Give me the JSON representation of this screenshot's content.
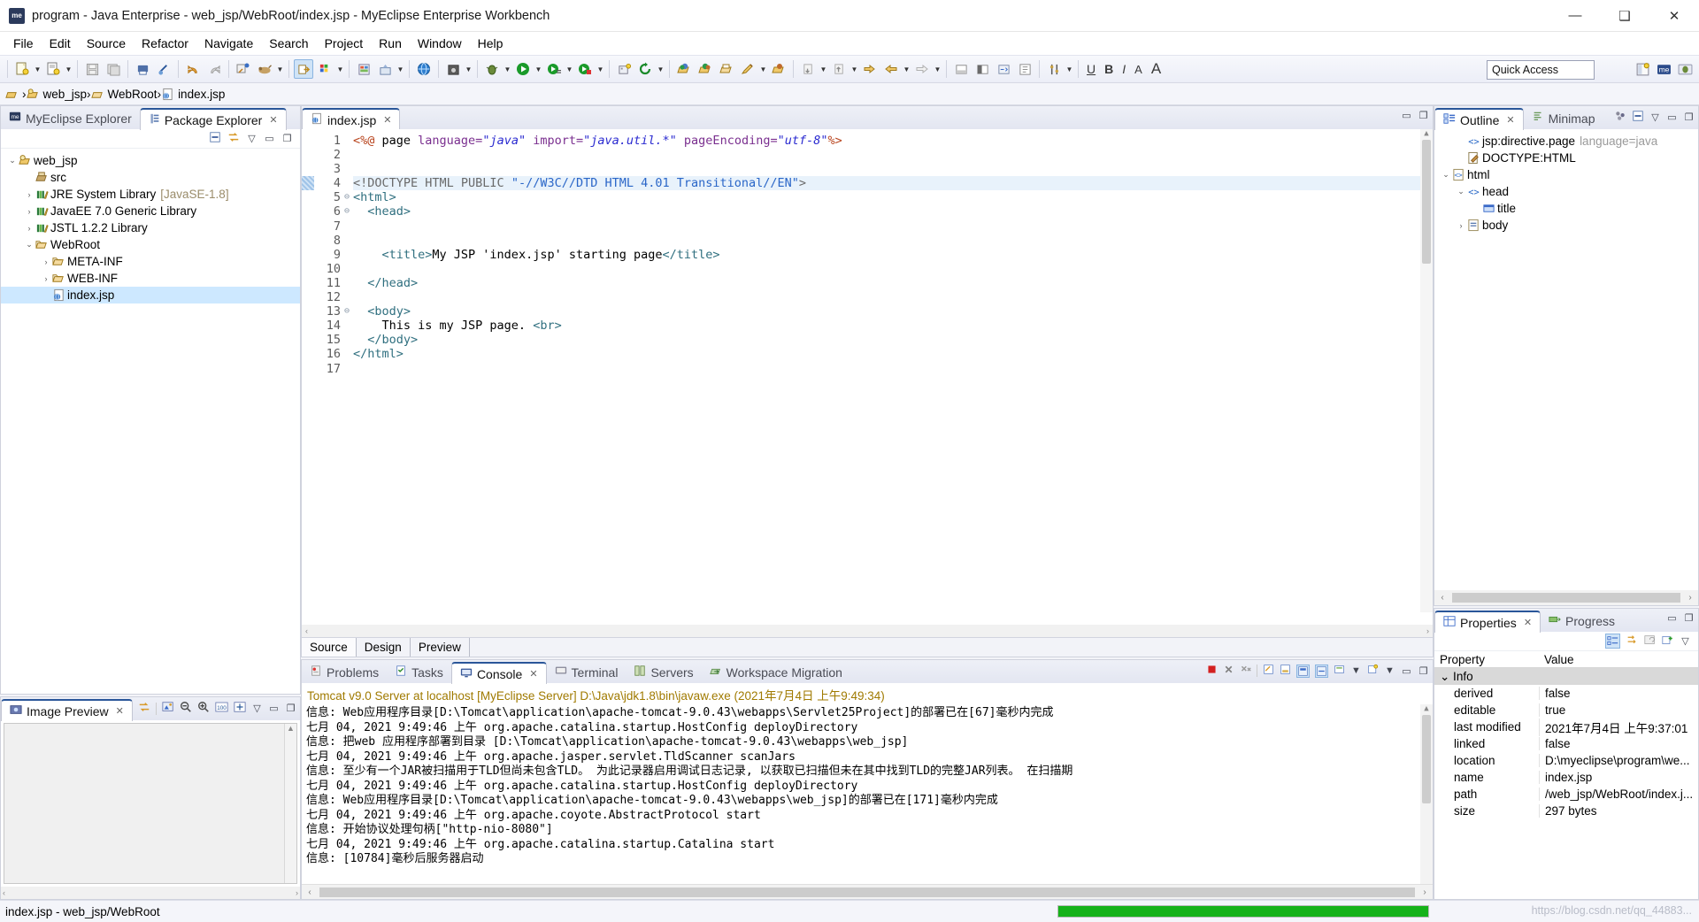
{
  "window": {
    "title": "program - Java Enterprise - web_jsp/WebRoot/index.jsp - MyEclipse Enterprise Workbench",
    "app_badge": "me",
    "minimize": "—",
    "maximize": "❑",
    "close": "✕"
  },
  "menu": [
    {
      "label": "File"
    },
    {
      "label": "Edit"
    },
    {
      "label": "Source"
    },
    {
      "label": "Refactor"
    },
    {
      "label": "Navigate"
    },
    {
      "label": "Search"
    },
    {
      "label": "Project"
    },
    {
      "label": "Run"
    },
    {
      "label": "Window"
    },
    {
      "label": "Help"
    }
  ],
  "toolbar": {
    "quick_access_value": "Quick Access",
    "text_buttons": [
      "U",
      "B",
      "I",
      "A",
      "A"
    ]
  },
  "breadcrumb": {
    "items": [
      "web_jsp",
      "WebRoot",
      "index.jsp"
    ],
    "separator": "›"
  },
  "explorer": {
    "tabs": [
      {
        "label": "MyEclipse Explorer",
        "active": false,
        "icon": "myeclipse-icon"
      },
      {
        "label": "Package Explorer",
        "active": true,
        "icon": "package-icon"
      }
    ],
    "tree": [
      {
        "label": "web_jsp",
        "indent": 0,
        "twist": "⌄",
        "icon": "project-icon",
        "dim": "",
        "selected": false
      },
      {
        "label": "src",
        "indent": 1,
        "twist": "",
        "icon": "source-folder-icon",
        "dim": "",
        "selected": false
      },
      {
        "label": "JRE System Library",
        "indent": 1,
        "twist": "›",
        "icon": "library-icon",
        "dim": "[JavaSE-1.8]",
        "selected": false
      },
      {
        "label": "JavaEE 7.0 Generic Library",
        "indent": 1,
        "twist": "›",
        "icon": "library-icon",
        "dim": "",
        "selected": false
      },
      {
        "label": "JSTL 1.2.2 Library",
        "indent": 1,
        "twist": "›",
        "icon": "library-icon",
        "dim": "",
        "selected": false
      },
      {
        "label": "WebRoot",
        "indent": 1,
        "twist": "⌄",
        "icon": "folder-icon",
        "dim": "",
        "selected": false
      },
      {
        "label": "META-INF",
        "indent": 2,
        "twist": "›",
        "icon": "folder-icon",
        "dim": "",
        "selected": false
      },
      {
        "label": "WEB-INF",
        "indent": 2,
        "twist": "›",
        "icon": "folder-icon",
        "dim": "",
        "selected": false
      },
      {
        "label": "index.jsp",
        "indent": 2,
        "twist": "",
        "icon": "jsp-file-icon",
        "dim": "",
        "selected": true
      }
    ]
  },
  "image_preview": {
    "tab_label": "Image Preview"
  },
  "editor": {
    "tab_label": "index.jsp",
    "source_tabs": [
      {
        "label": "Source",
        "active": true
      },
      {
        "label": "Design",
        "active": false
      },
      {
        "label": "Preview",
        "active": false
      }
    ],
    "total_lines": 17,
    "highlight_line": 4,
    "fold_lines": [
      5,
      6,
      13
    ],
    "lines": [
      {
        "n": 1,
        "segments": [
          {
            "t": "<%@ ",
            "c": "k-dir"
          },
          {
            "t": "page ",
            "c": "k-txt"
          },
          {
            "t": "language=",
            "c": "k-attr"
          },
          {
            "t": "\"java\"",
            "c": "k-str"
          },
          {
            "t": " import=",
            "c": "k-attr"
          },
          {
            "t": "\"java.util.*\"",
            "c": "k-str"
          },
          {
            "t": " pageEncoding=",
            "c": "k-attr"
          },
          {
            "t": "\"utf-8\"",
            "c": "k-str"
          },
          {
            "t": "%>",
            "c": "k-dir"
          }
        ]
      },
      {
        "n": 2,
        "segments": []
      },
      {
        "n": 3,
        "segments": []
      },
      {
        "n": 4,
        "segments": [
          {
            "t": "<!DOCTYPE HTML PUBLIC ",
            "c": "k-doc"
          },
          {
            "t": "\"-//W3C//DTD HTML 4.01 Transitional//EN\"",
            "c": "k-docs"
          },
          {
            "t": ">",
            "c": "k-doc"
          }
        ]
      },
      {
        "n": 5,
        "segments": [
          {
            "t": "<html>",
            "c": "k-tag"
          }
        ]
      },
      {
        "n": 6,
        "segments": [
          {
            "t": "  <head>",
            "c": "k-tag"
          }
        ]
      },
      {
        "n": 7,
        "segments": []
      },
      {
        "n": 8,
        "segments": []
      },
      {
        "n": 9,
        "segments": [
          {
            "t": "    <title>",
            "c": "k-tag"
          },
          {
            "t": "My JSP 'index.jsp' starting page",
            "c": "k-txt"
          },
          {
            "t": "</title>",
            "c": "k-tag"
          }
        ]
      },
      {
        "n": 10,
        "segments": []
      },
      {
        "n": 11,
        "segments": [
          {
            "t": "  </head>",
            "c": "k-tag"
          }
        ]
      },
      {
        "n": 12,
        "segments": []
      },
      {
        "n": 13,
        "segments": [
          {
            "t": "  <body>",
            "c": "k-tag"
          }
        ]
      },
      {
        "n": 14,
        "segments": [
          {
            "t": "    This is my JSP page. ",
            "c": "k-txt"
          },
          {
            "t": "<br>",
            "c": "k-tag"
          }
        ]
      },
      {
        "n": 15,
        "segments": [
          {
            "t": "  </body>",
            "c": "k-tag"
          }
        ]
      },
      {
        "n": 16,
        "segments": [
          {
            "t": "</html>",
            "c": "k-tag"
          }
        ]
      },
      {
        "n": 17,
        "segments": []
      }
    ]
  },
  "console": {
    "tabs": [
      {
        "label": "Problems",
        "active": false,
        "icon": "problems-icon"
      },
      {
        "label": "Tasks",
        "active": false,
        "icon": "tasks-icon"
      },
      {
        "label": "Console",
        "active": true,
        "icon": "console-icon"
      },
      {
        "label": "Terminal",
        "active": false,
        "icon": "terminal-icon"
      },
      {
        "label": "Servers",
        "active": false,
        "icon": "servers-icon"
      },
      {
        "label": "Workspace Migration",
        "active": false,
        "icon": "migration-icon"
      }
    ],
    "header": "Tomcat v9.0 Server at localhost [MyEclipse Server] D:\\Java\\jdk1.8\\bin\\javaw.exe (2021年7月4日 上午9:49:34)",
    "lines": [
      "信息: Web应用程序目录[D:\\Tomcat\\application\\apache-tomcat-9.0.43\\webapps\\Servlet25Project]的部署已在[67]毫秒内完成",
      "七月 04, 2021 9:49:46 上午 org.apache.catalina.startup.HostConfig deployDirectory",
      "信息: 把web 应用程序部署到目录 [D:\\Tomcat\\application\\apache-tomcat-9.0.43\\webapps\\web_jsp]",
      "七月 04, 2021 9:49:46 上午 org.apache.jasper.servlet.TldScanner scanJars",
      "信息: 至少有一个JAR被扫描用于TLD但尚未包含TLD。 为此记录器启用调试日志记录, 以获取已扫描但未在其中找到TLD的完整JAR列表。 在扫描期",
      "七月 04, 2021 9:49:46 上午 org.apache.catalina.startup.HostConfig deployDirectory",
      "信息: Web应用程序目录[D:\\Tomcat\\application\\apache-tomcat-9.0.43\\webapps\\web_jsp]的部署已在[171]毫秒内完成",
      "七月 04, 2021 9:49:46 上午 org.apache.coyote.AbstractProtocol start",
      "信息: 开始协议处理句柄[\"http-nio-8080\"]",
      "七月 04, 2021 9:49:46 上午 org.apache.catalina.startup.Catalina start",
      "信息: [10784]毫秒后服务器启动"
    ]
  },
  "outline": {
    "tabs": [
      {
        "label": "Outline",
        "active": true,
        "icon": "outline-icon"
      },
      {
        "label": "Minimap",
        "active": false,
        "icon": "minimap-icon"
      }
    ],
    "items": [
      {
        "label": "jsp:directive.page",
        "dim": "language=java",
        "indent": 1,
        "twist": "",
        "icon": "tag-icon"
      },
      {
        "label": "DOCTYPE:HTML",
        "dim": "",
        "indent": 1,
        "twist": "",
        "icon": "doctype-icon"
      },
      {
        "label": "html",
        "dim": "",
        "indent": 0,
        "twist": "⌄",
        "icon": "html-icon"
      },
      {
        "label": "head",
        "dim": "",
        "indent": 1,
        "twist": "⌄",
        "icon": "tag-icon"
      },
      {
        "label": "title",
        "dim": "",
        "indent": 2,
        "twist": "",
        "icon": "title-icon"
      },
      {
        "label": "body",
        "dim": "",
        "indent": 1,
        "twist": "›",
        "icon": "body-icon"
      }
    ]
  },
  "properties": {
    "tabs": [
      {
        "label": "Properties",
        "active": true,
        "icon": "properties-icon"
      },
      {
        "label": "Progress",
        "active": false,
        "icon": "progress-icon"
      }
    ],
    "columns": [
      "Property",
      "Value"
    ],
    "group_label": "Info",
    "rows": [
      {
        "key": "derived",
        "value": "false"
      },
      {
        "key": "editable",
        "value": "true"
      },
      {
        "key": "last modified",
        "value": "2021年7月4日 上午9:37:01"
      },
      {
        "key": "linked",
        "value": "false"
      },
      {
        "key": "location",
        "value": "D:\\myeclipse\\program\\we..."
      },
      {
        "key": "name",
        "value": "index.jsp"
      },
      {
        "key": "path",
        "value": "/web_jsp/WebRoot/index.j..."
      },
      {
        "key": "size",
        "value": "297  bytes"
      }
    ]
  },
  "statusbar": {
    "text": "index.jsp - web_jsp/WebRoot",
    "progress_percent": 100,
    "progress_color": "#16b21a",
    "watermark": "https://blog.csdn.net/qq_44883..."
  }
}
